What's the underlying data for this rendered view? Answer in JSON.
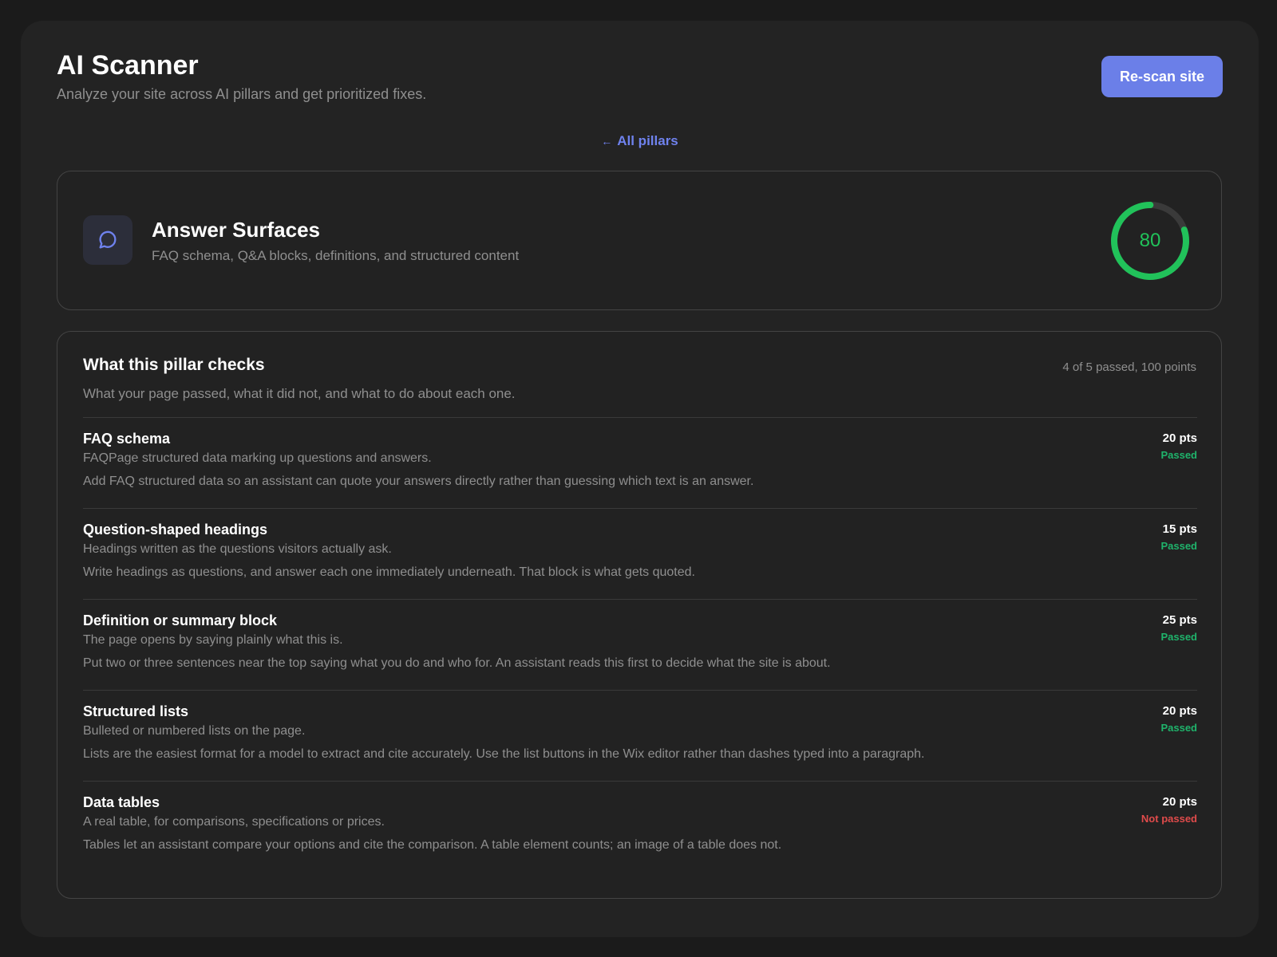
{
  "header": {
    "title": "AI Scanner",
    "subtitle": "Analyze your site across AI pillars and get prioritized fixes.",
    "rescan_label": "Re-scan site"
  },
  "nav": {
    "back_arrow": "←",
    "back_label": "All pillars"
  },
  "pillar": {
    "icon": "chat-bubble-icon",
    "name": "Answer Surfaces",
    "description": "FAQ schema, Q&A blocks, definitions, and structured content",
    "score": 80,
    "score_max": 100
  },
  "checks": {
    "title": "What this pillar checks",
    "summary": "4 of 5 passed, 100 points",
    "subtitle": "What your page passed, what it did not, and what to do about each one.",
    "items": [
      {
        "name": "FAQ schema",
        "description": "FAQPage structured data marking up questions and answers.",
        "advice": "Add FAQ structured data so an assistant can quote your answers directly rather than guessing which text is an answer.",
        "points": "20 pts",
        "status": "Passed",
        "passed": true
      },
      {
        "name": "Question-shaped headings",
        "description": "Headings written as the questions visitors actually ask.",
        "advice": "Write headings as questions, and answer each one immediately underneath. That block is what gets quoted.",
        "points": "15 pts",
        "status": "Passed",
        "passed": true
      },
      {
        "name": "Definition or summary block",
        "description": "The page opens by saying plainly what this is.",
        "advice": "Put two or three sentences near the top saying what you do and who for. An assistant reads this first to decide what the site is about.",
        "points": "25 pts",
        "status": "Passed",
        "passed": true
      },
      {
        "name": "Structured lists",
        "description": "Bulleted or numbered lists on the page.",
        "advice": "Lists are the easiest format for a model to extract and cite accurately. Use the list buttons in the Wix editor rather than dashes typed into a paragraph.",
        "points": "20 pts",
        "status": "Passed",
        "passed": true
      },
      {
        "name": "Data tables",
        "description": "A real table, for comparisons, specifications or prices.",
        "advice": "Tables let an assistant compare your options and cite the comparison. A table element counts; an image of a table does not.",
        "points": "20 pts",
        "status": "Not passed",
        "passed": false
      }
    ]
  },
  "colors": {
    "accent": "#6b7fe8",
    "score_ring": "#21c25a",
    "score_track": "#3a3a3a",
    "passed": "#1fb36b",
    "failed": "#e04b4b"
  }
}
